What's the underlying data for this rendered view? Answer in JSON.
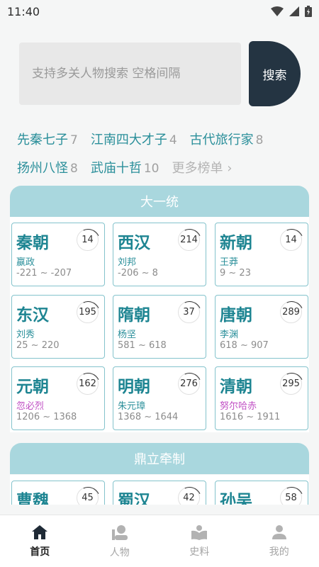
{
  "status": {
    "time": "11:40"
  },
  "search": {
    "placeholder": "支持多关人物搜索 空格间隔",
    "button": "搜索"
  },
  "rankings": {
    "rows": [
      [
        {
          "name": "先秦七子",
          "count": "7"
        },
        {
          "name": "江南四大才子",
          "count": "4"
        },
        {
          "name": "古代旅行家",
          "count": "8"
        }
      ],
      [
        {
          "name": "扬州八怪",
          "count": "8"
        },
        {
          "name": "武庙十哲",
          "count": "10"
        }
      ]
    ],
    "more": "更多榜单 ›"
  },
  "sections": [
    {
      "title": "大一统",
      "cards": [
        {
          "name": "秦朝",
          "count": "14",
          "ruler": "嬴政",
          "period": "-221 ~ -207",
          "ruler_color": "teal"
        },
        {
          "name": "西汉",
          "count": "214",
          "ruler": "刘邦",
          "period": "-206 ~ 8",
          "ruler_color": "teal"
        },
        {
          "name": "新朝",
          "count": "14",
          "ruler": "王莽",
          "period": "9 ~ 23",
          "ruler_color": "teal"
        },
        {
          "name": "东汉",
          "count": "195",
          "ruler": "刘秀",
          "period": "25 ~ 220",
          "ruler_color": "teal"
        },
        {
          "name": "隋朝",
          "count": "37",
          "ruler": "杨坚",
          "period": "581 ~ 618",
          "ruler_color": "teal"
        },
        {
          "name": "唐朝",
          "count": "289",
          "ruler": "李渊",
          "period": "618 ~ 907",
          "ruler_color": "teal"
        },
        {
          "name": "元朝",
          "count": "162",
          "ruler": "忽必烈",
          "period": "1206 ~ 1368",
          "ruler_color": "purple"
        },
        {
          "name": "明朝",
          "count": "276",
          "ruler": "朱元璋",
          "period": "1368 ~ 1644",
          "ruler_color": "teal"
        },
        {
          "name": "清朝",
          "count": "295",
          "ruler": "努尔哈赤",
          "period": "1616 ~ 1911",
          "ruler_color": "purple"
        }
      ]
    },
    {
      "title": "鼎立牵制",
      "cards": [
        {
          "name": "曹魏",
          "count": "45"
        },
        {
          "name": "蜀汉",
          "count": "42"
        },
        {
          "name": "孙吴",
          "count": "58"
        }
      ]
    }
  ],
  "nav": [
    {
      "label": "首页",
      "icon": "home-icon",
      "active": true
    },
    {
      "label": "人物",
      "icon": "person-icon",
      "active": false
    },
    {
      "label": "史料",
      "icon": "book-icon",
      "active": false
    },
    {
      "label": "我的",
      "icon": "profile-icon",
      "active": false
    }
  ],
  "colors": {
    "accent": "#1e8592",
    "section_header": "#a9d7de",
    "search_button": "#243442",
    "ruler_purple": "#c04fc4"
  }
}
